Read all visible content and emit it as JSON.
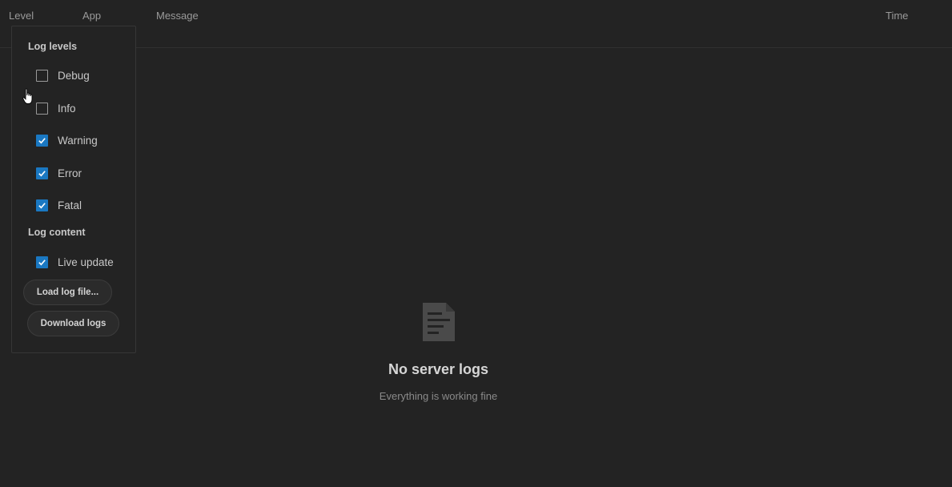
{
  "header": {
    "columns": [
      "Level",
      "App",
      "Message",
      "Time"
    ]
  },
  "filter_panel": {
    "log_levels_title": "Log levels",
    "levels": [
      {
        "label": "Debug",
        "checked": false
      },
      {
        "label": "Info",
        "checked": false
      },
      {
        "label": "Warning",
        "checked": true
      },
      {
        "label": "Error",
        "checked": true
      },
      {
        "label": "Fatal",
        "checked": true
      }
    ],
    "log_content_title": "Log content",
    "live_update": {
      "label": "Live update",
      "checked": true
    },
    "load_button": "Load log file...",
    "download_button": "Download logs"
  },
  "empty_state": {
    "icon": "document-icon",
    "title": "No server logs",
    "subtitle": "Everything is working fine"
  },
  "colors": {
    "background": "#232323",
    "accent": "#1a78c2"
  }
}
